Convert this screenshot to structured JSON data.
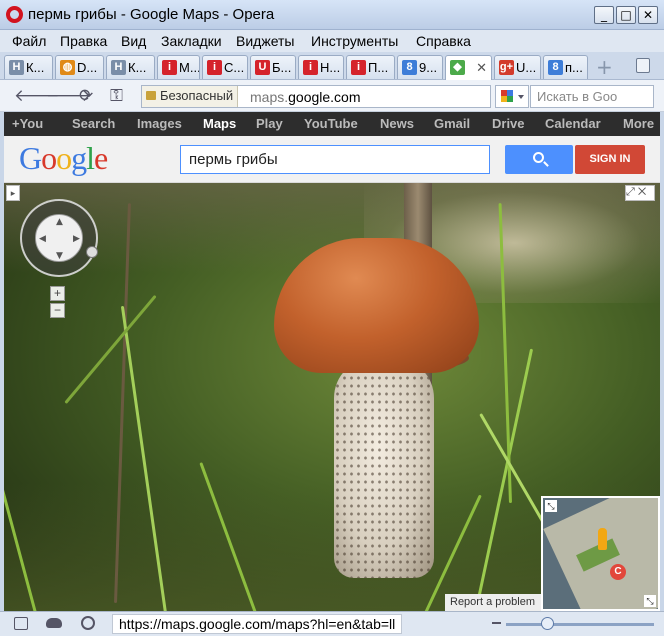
{
  "window": {
    "title": "пермь грибы - Google Maps - Opera",
    "controls": {
      "minimize": "_",
      "maximize": "□",
      "close": "✕"
    }
  },
  "menu": [
    "Файл",
    "Правка",
    "Вид",
    "Закладки",
    "Виджеты",
    "Инструменты",
    "Справка"
  ],
  "tabs": [
    {
      "label": "К...",
      "icon": "H",
      "icon_color": "#7a8ea8"
    },
    {
      "label": "D...",
      "icon": "◍",
      "icon_color": "#e08a18"
    },
    {
      "label": "К...",
      "icon": "H",
      "icon_color": "#7a8ea8"
    },
    {
      "label": "М...",
      "icon": "i",
      "icon_color": "#d5232b"
    },
    {
      "label": "С...",
      "icon": "i",
      "icon_color": "#d5232b"
    },
    {
      "label": "Б...",
      "icon": "U",
      "icon_color": "#d5232b"
    },
    {
      "label": "Н...",
      "icon": "i",
      "icon_color": "#d5232b"
    },
    {
      "label": "П...",
      "icon": "i",
      "icon_color": "#d5232b"
    },
    {
      "label": "9...",
      "icon": "8",
      "icon_color": "#3d7dd8"
    },
    {
      "label": "",
      "icon": "◆",
      "icon_color": "#4caa4a",
      "active": true,
      "close": "✕"
    },
    {
      "label": "U...",
      "icon": "g+",
      "icon_color": "#d33b2b"
    },
    {
      "label": "п...",
      "icon": "8",
      "icon_color": "#3d7dd8"
    }
  ],
  "tabbar": {
    "new_tab": "+",
    "trash": "trash-icon"
  },
  "nav": {
    "back": "🡐",
    "forward": "🡒",
    "reload": "⟳",
    "key": "⚿",
    "secure_label": "Безопасный",
    "url_prefix": "maps.",
    "url_domain": "google.com",
    "search_placeholder": "Искать в Goo"
  },
  "gbar": [
    {
      "label": "+You"
    },
    {
      "label": "Search"
    },
    {
      "label": "Images"
    },
    {
      "label": "Maps",
      "current": true
    },
    {
      "label": "Play"
    },
    {
      "label": "YouTube"
    },
    {
      "label": "News"
    },
    {
      "label": "Gmail"
    },
    {
      "label": "Drive"
    },
    {
      "label": "Calendar"
    },
    {
      "label": "More"
    }
  ],
  "google": {
    "logo_letters": [
      {
        "ch": "G",
        "color": "#3d7ae0"
      },
      {
        "ch": "o",
        "color": "#d8392b"
      },
      {
        "ch": "o",
        "color": "#f0b21b"
      },
      {
        "ch": "g",
        "color": "#3d7ae0"
      },
      {
        "ch": "l",
        "color": "#2fa24a"
      },
      {
        "ch": "e",
        "color": "#d8392b"
      }
    ],
    "query": "пермь грибы",
    "signin": "SIGN IN"
  },
  "streetview": {
    "zoom_in": "+",
    "zoom_out": "−",
    "report": "Report a problem",
    "marker_letter": "C",
    "arrows": {
      "up": "▲",
      "down": "▼",
      "left": "◀",
      "right": "▶"
    },
    "expand": "⤢ ✕",
    "collapse": "▸"
  },
  "status": {
    "url": "https://maps.google.com/maps?hl=en&tab=ll"
  },
  "colors": {
    "gbar_bg": "#2d2d2d",
    "search_blue": "#4d90fe",
    "signin_red": "#d14836",
    "cap": "#c2612c"
  }
}
